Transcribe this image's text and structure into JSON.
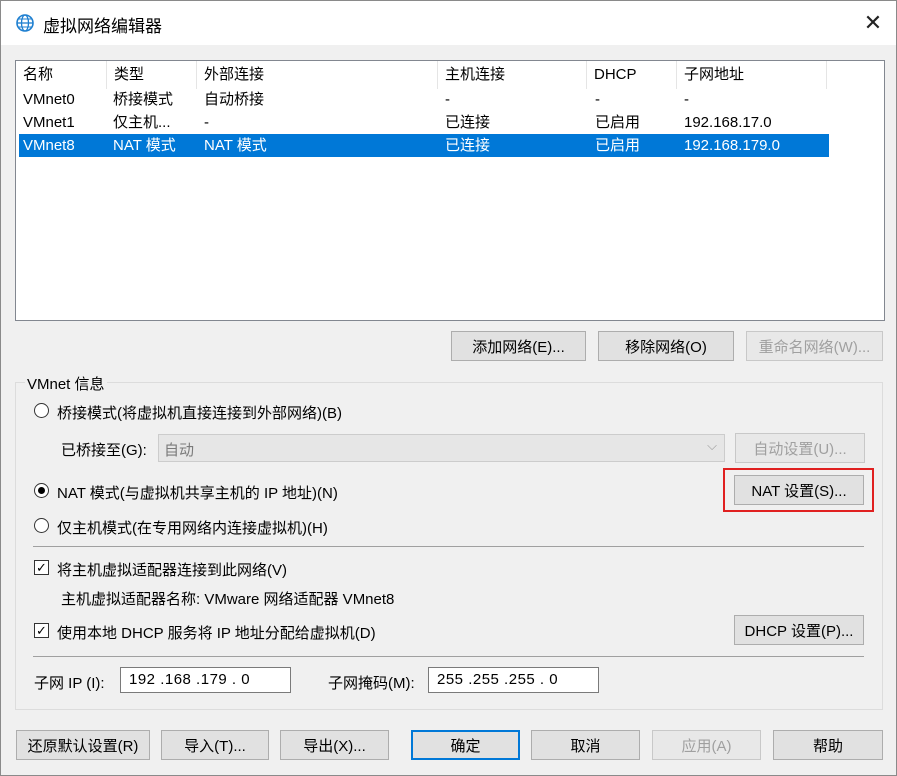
{
  "window": {
    "title": "虚拟网络编辑器"
  },
  "network_list": {
    "columns": [
      "名称",
      "类型",
      "外部连接",
      "主机连接",
      "DHCP",
      "子网地址"
    ],
    "rows": [
      {
        "name": "VMnet0",
        "type": "桥接模式",
        "external": "自动桥接",
        "host": "-",
        "dhcp": "-",
        "subnet": "-",
        "selected": false
      },
      {
        "name": "VMnet1",
        "type": "仅主机...",
        "external": "-",
        "host": "已连接",
        "dhcp": "已启用",
        "subnet": "192.168.17.0",
        "selected": false
      },
      {
        "name": "VMnet8",
        "type": "NAT 模式",
        "external": "NAT 模式",
        "host": "已连接",
        "dhcp": "已启用",
        "subnet": "192.168.179.0",
        "selected": true
      }
    ]
  },
  "list_buttons": {
    "add": "添加网络(E)...",
    "remove": "移除网络(O)",
    "rename": "重命名网络(W)..."
  },
  "vmnet_info": {
    "group_label": "VMnet 信息",
    "bridged_radio": "桥接模式(将虚拟机直接连接到外部网络)(B)",
    "bridged_to_label": "已桥接至(G):",
    "bridged_to_value": "自动",
    "auto_settings": "自动设置(U)...",
    "nat_radio": "NAT 模式(与虚拟机共享主机的 IP 地址)(N)",
    "nat_settings": "NAT 设置(S)...",
    "hostonly_radio": "仅主机模式(在专用网络内连接虚拟机)(H)",
    "selected_mode": "nat",
    "connect_adapter_check": "将主机虚拟适配器连接到此网络(V)",
    "connect_adapter_checked": true,
    "adapter_name": "主机虚拟适配器名称: VMware 网络适配器 VMnet8",
    "dhcp_check": "使用本地 DHCP 服务将 IP 地址分配给虚拟机(D)",
    "dhcp_checked": true,
    "dhcp_settings": "DHCP 设置(P)...",
    "subnet_ip_label": "子网 IP (I):",
    "subnet_ip": "192 .168 .179 .  0",
    "subnet_mask_label": "子网掩码(M):",
    "subnet_mask": "255 .255 .255 .  0"
  },
  "footer": {
    "restore": "还原默认设置(R)",
    "import": "导入(T)...",
    "export": "导出(X)...",
    "ok": "确定",
    "cancel": "取消",
    "apply": "应用(A)",
    "help": "帮助"
  },
  "colors": {
    "selection": "#0078d7",
    "highlight_box": "#e02020"
  }
}
